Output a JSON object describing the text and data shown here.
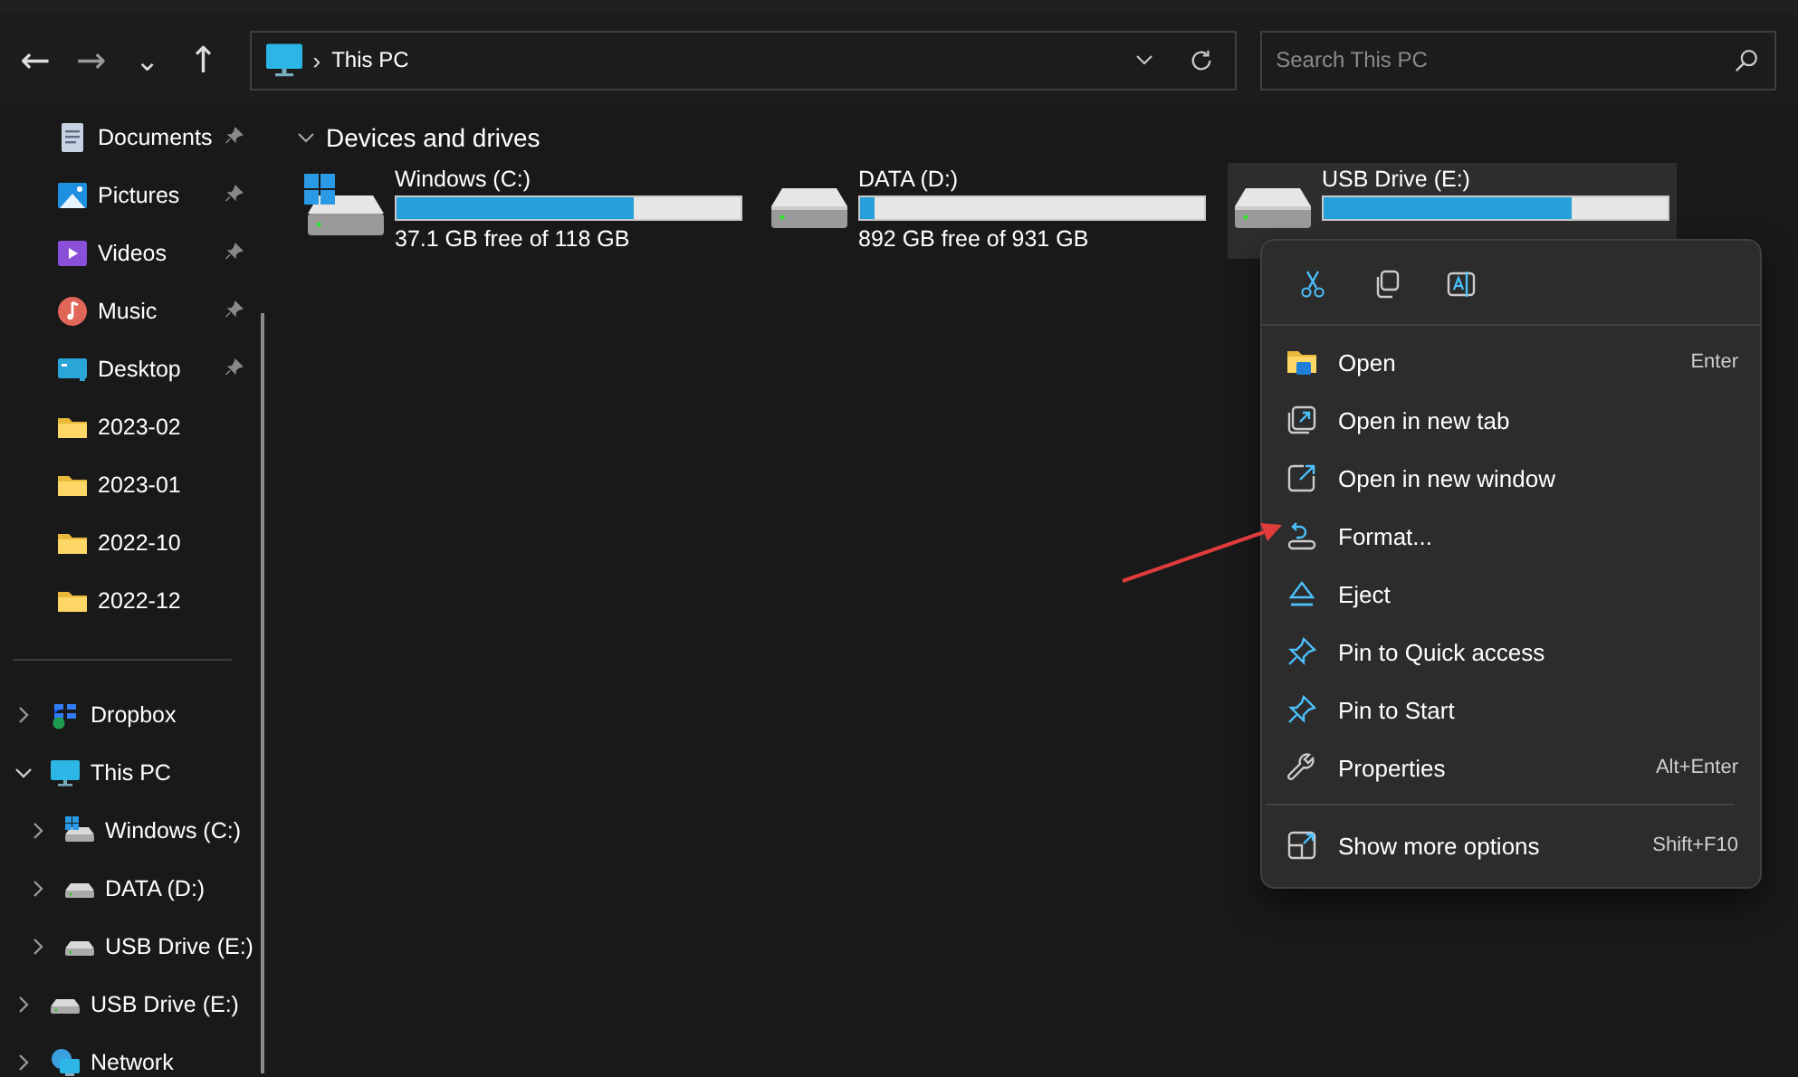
{
  "toolbar": {
    "back": "←",
    "forward": "→",
    "recent": "⌄",
    "up": "↑",
    "address": {
      "separator": "›",
      "location": "This PC"
    },
    "search": {
      "placeholder": "Search This PC"
    }
  },
  "sidebar": {
    "quick_access": [
      {
        "label": "Documents",
        "kind": "documents",
        "pinned": true
      },
      {
        "label": "Pictures",
        "kind": "pictures",
        "pinned": true
      },
      {
        "label": "Videos",
        "kind": "videos",
        "pinned": true
      },
      {
        "label": "Music",
        "kind": "music",
        "pinned": true
      },
      {
        "label": "Desktop",
        "kind": "desktop",
        "pinned": true
      },
      {
        "label": "2023-02",
        "kind": "folder",
        "pinned": false
      },
      {
        "label": "2023-01",
        "kind": "folder",
        "pinned": false
      },
      {
        "label": "2022-10",
        "kind": "folder",
        "pinned": false
      },
      {
        "label": "2022-12",
        "kind": "folder",
        "pinned": false
      }
    ],
    "tree": [
      {
        "label": "Dropbox",
        "kind": "dropbox",
        "expanded": false
      },
      {
        "label": "This PC",
        "kind": "pc",
        "expanded": true,
        "children": [
          {
            "label": "Windows (C:)",
            "kind": "system",
            "expanded": false
          },
          {
            "label": "DATA (D:)",
            "kind": "drive",
            "expanded": false
          },
          {
            "label": "USB Drive (E:)",
            "kind": "drive",
            "expanded": false
          }
        ]
      },
      {
        "label": "USB Drive (E:)",
        "kind": "drive",
        "expanded": false
      },
      {
        "label": "Network",
        "kind": "network",
        "expanded": false
      }
    ]
  },
  "content": {
    "group": {
      "title": "Devices and drives",
      "expanded": true
    },
    "drives": [
      {
        "name": "Windows (C:)",
        "kind": "system",
        "level": 0.69,
        "space": "37.1 GB free of 118 GB",
        "selected": false
      },
      {
        "name": "DATA (D:)",
        "kind": "drive",
        "level": 0.04,
        "space": "892 GB free of 931 GB",
        "selected": false
      },
      {
        "name": "USB Drive (E:)",
        "kind": "drive",
        "level": 0.72,
        "selected": true
      }
    ]
  },
  "context_menu": {
    "quick_actions": [
      {
        "kind": "cut"
      },
      {
        "kind": "copy"
      },
      {
        "kind": "rename"
      }
    ],
    "items": [
      {
        "label": "Open",
        "kind": "open",
        "shortcut": "Enter"
      },
      {
        "label": "Open in new tab",
        "kind": "newtab"
      },
      {
        "label": "Open in new window",
        "kind": "newwindow"
      },
      {
        "label": "Format...",
        "kind": "format"
      },
      {
        "label": "Eject",
        "kind": "eject"
      },
      {
        "label": "Pin to Quick access",
        "kind": "pin"
      },
      {
        "label": "Pin to Start",
        "kind": "pin"
      },
      {
        "label": "Properties",
        "kind": "properties",
        "shortcut": "Alt+Enter"
      },
      {
        "label": "Show more options",
        "kind": "more",
        "shortcut": "Shift+F10",
        "separated": true
      }
    ]
  },
  "annotation": {
    "kind": "arrow"
  }
}
